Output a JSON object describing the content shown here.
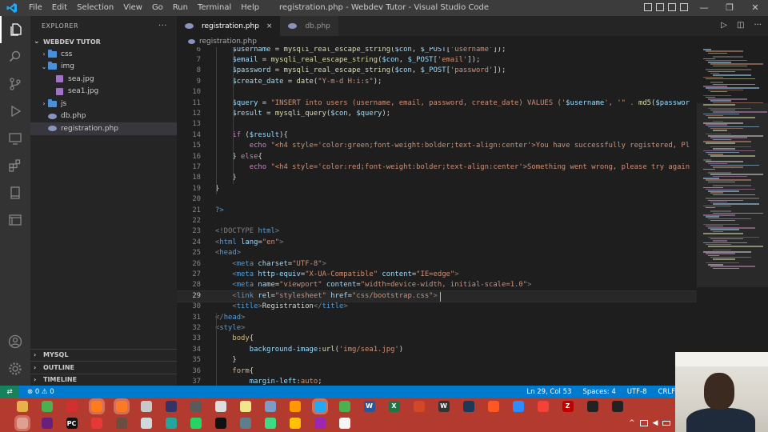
{
  "window": {
    "title": "registration.php - Webdev Tutor - Visual Studio Code",
    "menu": [
      "File",
      "Edit",
      "Selection",
      "View",
      "Go",
      "Run",
      "Terminal",
      "Help"
    ],
    "controls": [
      "—",
      "❐",
      "✕"
    ]
  },
  "activity_bar": {
    "items": [
      "explorer-icon",
      "search-icon",
      "source-control-icon",
      "run-debug-icon",
      "remote-explorer-icon",
      "extensions-icon",
      "notebook-icon",
      "panel-icon"
    ],
    "bottom": [
      "account-icon",
      "settings-gear-icon"
    ]
  },
  "sidebar": {
    "header": "EXPLORER",
    "more": "···",
    "root": "WEBDEV TUTOR",
    "tree": [
      {
        "label": "css",
        "type": "folder",
        "depth": 1,
        "chev": "›"
      },
      {
        "label": "img",
        "type": "folder",
        "depth": 1,
        "chev": "⌄"
      },
      {
        "label": "sea.jpg",
        "type": "image",
        "depth": 2,
        "chev": ""
      },
      {
        "label": "sea1.jpg",
        "type": "image",
        "depth": 2,
        "chev": ""
      },
      {
        "label": "js",
        "type": "folder",
        "depth": 1,
        "chev": "›"
      },
      {
        "label": "db.php",
        "type": "php",
        "depth": 1,
        "chev": ""
      },
      {
        "label": "registration.php",
        "type": "php",
        "depth": 1,
        "chev": "",
        "selected": true
      }
    ],
    "bottom_sections": [
      "MYSQL",
      "OUTLINE",
      "TIMELINE"
    ]
  },
  "tabs": [
    {
      "label": "registration.php",
      "active": true,
      "close": "×"
    },
    {
      "label": "db.php",
      "active": false,
      "close": ""
    }
  ],
  "breadcrumb": "registration.php",
  "editor": {
    "lines": [
      {
        "n": "6",
        "indent": 4,
        "tokens": [
          [
            "$username",
            "#9cdcfe"
          ],
          [
            " = ",
            "#d4d4d4"
          ],
          [
            "mysqli_real_escape_string",
            "#dcdcaa"
          ],
          [
            "(",
            "#d4d4d4"
          ],
          [
            "$con",
            "#9cdcfe"
          ],
          [
            ", ",
            "#d4d4d4"
          ],
          [
            "$_POST",
            "#9cdcfe"
          ],
          [
            "[",
            "#d4d4d4"
          ],
          [
            "'username'",
            "#ce9178"
          ],
          [
            "]);",
            "#d4d4d4"
          ]
        ]
      },
      {
        "n": "7",
        "indent": 4,
        "tokens": [
          [
            "$email",
            "#9cdcfe"
          ],
          [
            " = ",
            "#d4d4d4"
          ],
          [
            "mysqli_real_escape_string",
            "#dcdcaa"
          ],
          [
            "(",
            "#d4d4d4"
          ],
          [
            "$con",
            "#9cdcfe"
          ],
          [
            ", ",
            "#d4d4d4"
          ],
          [
            "$_POST",
            "#9cdcfe"
          ],
          [
            "[",
            "#d4d4d4"
          ],
          [
            "'email'",
            "#ce9178"
          ],
          [
            "]);",
            "#d4d4d4"
          ]
        ]
      },
      {
        "n": "8",
        "indent": 4,
        "tokens": [
          [
            "$password",
            "#9cdcfe"
          ],
          [
            " = ",
            "#d4d4d4"
          ],
          [
            "mysqli_real_escape_string",
            "#dcdcaa"
          ],
          [
            "(",
            "#d4d4d4"
          ],
          [
            "$con",
            "#9cdcfe"
          ],
          [
            ", ",
            "#d4d4d4"
          ],
          [
            "$_POST",
            "#9cdcfe"
          ],
          [
            "[",
            "#d4d4d4"
          ],
          [
            "'password'",
            "#ce9178"
          ],
          [
            "]);",
            "#d4d4d4"
          ]
        ]
      },
      {
        "n": "9",
        "indent": 4,
        "tokens": [
          [
            "$create_date",
            "#9cdcfe"
          ],
          [
            " = ",
            "#d4d4d4"
          ],
          [
            "date",
            "#dcdcaa"
          ],
          [
            "(",
            "#d4d4d4"
          ],
          [
            "\"Y-m-d H:i:s\"",
            "#ce9178"
          ],
          [
            ");",
            "#d4d4d4"
          ]
        ]
      },
      {
        "n": "10",
        "indent": 0,
        "tokens": []
      },
      {
        "n": "11",
        "indent": 4,
        "tokens": [
          [
            "$query",
            "#9cdcfe"
          ],
          [
            " = ",
            "#d4d4d4"
          ],
          [
            "\"INSERT into users (username, email, password, create_date) VALUES ('",
            "#ce9178"
          ],
          [
            "$username",
            "#9cdcfe"
          ],
          [
            "', '\" . ",
            "#ce9178"
          ],
          [
            "md5",
            "#dcdcaa"
          ],
          [
            "(",
            "#d4d4d4"
          ],
          [
            "$passwor",
            "#9cdcfe"
          ]
        ]
      },
      {
        "n": "12",
        "indent": 4,
        "tokens": [
          [
            "$result",
            "#9cdcfe"
          ],
          [
            " = ",
            "#d4d4d4"
          ],
          [
            "mysqli_query",
            "#dcdcaa"
          ],
          [
            "(",
            "#d4d4d4"
          ],
          [
            "$con",
            "#9cdcfe"
          ],
          [
            ", ",
            "#d4d4d4"
          ],
          [
            "$query",
            "#9cdcfe"
          ],
          [
            ");",
            "#d4d4d4"
          ]
        ]
      },
      {
        "n": "13",
        "indent": 0,
        "tokens": []
      },
      {
        "n": "14",
        "indent": 4,
        "tokens": [
          [
            "if",
            "#c586c0"
          ],
          [
            " (",
            "#d4d4d4"
          ],
          [
            "$result",
            "#9cdcfe"
          ],
          [
            "){",
            "#d4d4d4"
          ]
        ]
      },
      {
        "n": "15",
        "indent": 8,
        "tokens": [
          [
            "echo",
            "#c586c0"
          ],
          [
            " ",
            "#d4d4d4"
          ],
          [
            "\"<h4 style='color:green;font-weight:bolder;text-align:center'>You have successfully registered, Pl",
            "#ce9178"
          ]
        ]
      },
      {
        "n": "16",
        "indent": 4,
        "tokens": [
          [
            "}",
            "#d4d4d4"
          ],
          [
            " else",
            "#c586c0"
          ],
          [
            "{",
            "#d4d4d4"
          ]
        ]
      },
      {
        "n": "17",
        "indent": 8,
        "tokens": [
          [
            "echo",
            "#c586c0"
          ],
          [
            " ",
            "#d4d4d4"
          ],
          [
            "\"<h4 style='color:red;font-weight:bolder;text-align:center'>Something went wrong, please try again",
            "#ce9178"
          ]
        ]
      },
      {
        "n": "18",
        "indent": 4,
        "tokens": [
          [
            "}",
            "#d4d4d4"
          ]
        ]
      },
      {
        "n": "19",
        "indent": 0,
        "tokens": [
          [
            "}",
            "#d4d4d4"
          ]
        ]
      },
      {
        "n": "20",
        "indent": 0,
        "tokens": []
      },
      {
        "n": "21",
        "indent": 0,
        "tokens": [
          [
            "?>",
            "#569cd6"
          ]
        ]
      },
      {
        "n": "22",
        "indent": 0,
        "tokens": []
      },
      {
        "n": "23",
        "indent": 0,
        "tokens": [
          [
            "<!DOCTYPE ",
            "#808080"
          ],
          [
            "html",
            "#569cd6"
          ],
          [
            ">",
            "#808080"
          ]
        ]
      },
      {
        "n": "24",
        "indent": 0,
        "tokens": [
          [
            "<",
            "#808080"
          ],
          [
            "html",
            "#569cd6"
          ],
          [
            " lang",
            "#9cdcfe"
          ],
          [
            "=",
            "#d4d4d4"
          ],
          [
            "\"en\"",
            "#ce9178"
          ],
          [
            ">",
            "#808080"
          ]
        ]
      },
      {
        "n": "25",
        "indent": 0,
        "tokens": [
          [
            "<",
            "#808080"
          ],
          [
            "head",
            "#569cd6"
          ],
          [
            ">",
            "#808080"
          ]
        ]
      },
      {
        "n": "26",
        "indent": 4,
        "tokens": [
          [
            "<",
            "#808080"
          ],
          [
            "meta",
            "#569cd6"
          ],
          [
            " charset",
            "#9cdcfe"
          ],
          [
            "=",
            "#d4d4d4"
          ],
          [
            "\"UTF-8\"",
            "#ce9178"
          ],
          [
            ">",
            "#808080"
          ]
        ]
      },
      {
        "n": "27",
        "indent": 4,
        "tokens": [
          [
            "<",
            "#808080"
          ],
          [
            "meta",
            "#569cd6"
          ],
          [
            " http-equiv",
            "#9cdcfe"
          ],
          [
            "=",
            "#d4d4d4"
          ],
          [
            "\"X-UA-Compatible\"",
            "#ce9178"
          ],
          [
            " content",
            "#9cdcfe"
          ],
          [
            "=",
            "#d4d4d4"
          ],
          [
            "\"IE=edge\"",
            "#ce9178"
          ],
          [
            ">",
            "#808080"
          ]
        ]
      },
      {
        "n": "28",
        "indent": 4,
        "tokens": [
          [
            "<",
            "#808080"
          ],
          [
            "meta",
            "#569cd6"
          ],
          [
            " name",
            "#9cdcfe"
          ],
          [
            "=",
            "#d4d4d4"
          ],
          [
            "\"viewport\"",
            "#ce9178"
          ],
          [
            " content",
            "#9cdcfe"
          ],
          [
            "=",
            "#d4d4d4"
          ],
          [
            "\"width=device-width, initial-scale=1.0\"",
            "#ce9178"
          ],
          [
            ">",
            "#808080"
          ]
        ]
      },
      {
        "n": "29",
        "indent": 4,
        "current": true,
        "tokens": [
          [
            "<",
            "#808080"
          ],
          [
            "link",
            "#569cd6"
          ],
          [
            " rel",
            "#9cdcfe"
          ],
          [
            "=",
            "#d4d4d4"
          ],
          [
            "\"stylesheet\"",
            "#ce9178"
          ],
          [
            " href",
            "#9cdcfe"
          ],
          [
            "=",
            "#d4d4d4"
          ],
          [
            "\"css/bootstrap.css\"",
            "#ce9178"
          ],
          [
            ">",
            "#808080"
          ]
        ]
      },
      {
        "n": "30",
        "indent": 4,
        "tokens": [
          [
            "<",
            "#808080"
          ],
          [
            "title",
            "#569cd6"
          ],
          [
            ">",
            "#808080"
          ],
          [
            "Registration",
            "#d4d4d4"
          ],
          [
            "</",
            "#808080"
          ],
          [
            "title",
            "#569cd6"
          ],
          [
            ">",
            "#808080"
          ]
        ]
      },
      {
        "n": "31",
        "indent": 0,
        "tokens": [
          [
            "</",
            "#808080"
          ],
          [
            "head",
            "#569cd6"
          ],
          [
            ">",
            "#808080"
          ]
        ]
      },
      {
        "n": "32",
        "indent": 0,
        "tokens": [
          [
            "<",
            "#808080"
          ],
          [
            "style",
            "#569cd6"
          ],
          [
            ">",
            "#808080"
          ]
        ]
      },
      {
        "n": "33",
        "indent": 4,
        "tokens": [
          [
            "body",
            "#d7ba7d"
          ],
          [
            "{",
            "#d4d4d4"
          ]
        ]
      },
      {
        "n": "34",
        "indent": 8,
        "tokens": [
          [
            "background-image",
            "#9cdcfe"
          ],
          [
            ":",
            "#d4d4d4"
          ],
          [
            "url",
            "#dcdcaa"
          ],
          [
            "(",
            "#d4d4d4"
          ],
          [
            "'img/sea1.jpg'",
            "#ce9178"
          ],
          [
            ")",
            "#d4d4d4"
          ]
        ]
      },
      {
        "n": "35",
        "indent": 4,
        "tokens": [
          [
            "}",
            "#d4d4d4"
          ]
        ]
      },
      {
        "n": "36",
        "indent": 4,
        "tokens": [
          [
            "form",
            "#d7ba7d"
          ],
          [
            "{",
            "#d4d4d4"
          ]
        ]
      },
      {
        "n": "37",
        "indent": 8,
        "tokens": [
          [
            "margin-left",
            "#9cdcfe"
          ],
          [
            ":",
            "#d4d4d4"
          ],
          [
            "auto",
            "#ce9178"
          ],
          [
            ";",
            "#d4d4d4"
          ]
        ]
      }
    ]
  },
  "statusbar": {
    "remote": "⇄",
    "problems": "⊗ 0 ⚠ 0",
    "position": "Ln 29, Col 53",
    "spaces": "Spaces: 4",
    "encoding": "UTF-8",
    "eol": "CRLF"
  },
  "taskbar_top": {
    "icons": [
      {
        "name": "folder-icon",
        "color": "#e8b04a"
      },
      {
        "name": "chrome-icon",
        "color": "#4caf50"
      },
      {
        "name": "opera-icon",
        "color": "#d32f2f"
      },
      {
        "name": "firefox-icon",
        "color": "#ff7b1c",
        "active": true
      },
      {
        "name": "xampp-icon",
        "color": "#fb7a24",
        "active": true
      },
      {
        "name": "bin-icon",
        "color": "#c8c8c8"
      },
      {
        "name": "media-icon",
        "color": "#333366"
      },
      {
        "name": "app-icon",
        "color": "#5a5a5a"
      },
      {
        "name": "tools-icon",
        "color": "#dddddd"
      },
      {
        "name": "notes-icon",
        "color": "#f0e68c"
      },
      {
        "name": "box-icon",
        "color": "#7a9cc6"
      },
      {
        "name": "sublime-icon",
        "color": "#ff9800"
      },
      {
        "name": "vscode-icon",
        "color": "#23a9f2",
        "active": true
      },
      {
        "name": "green-app-icon",
        "color": "#4caf50"
      },
      {
        "name": "word-icon",
        "color": "#2b579a",
        "text": "W"
      },
      {
        "name": "excel-icon",
        "color": "#217346",
        "text": "X"
      },
      {
        "name": "powerpoint-icon",
        "color": "#d24726"
      },
      {
        "name": "wordpad-icon",
        "color": "#333333",
        "text": "W"
      },
      {
        "name": "camtasia-icon",
        "color": "#1c3a57"
      },
      {
        "name": "record-icon",
        "color": "#ff5722"
      },
      {
        "name": "zoom-icon",
        "color": "#2d8cff"
      },
      {
        "name": "flag-icon",
        "color": "#f44336"
      },
      {
        "name": "filezilla-icon",
        "color": "#bf0000",
        "text": "Z"
      },
      {
        "name": "server-icon",
        "color": "#222222"
      },
      {
        "name": "git-icon",
        "color": "#222222"
      }
    ]
  },
  "taskbar_bottom": {
    "icons": [
      {
        "name": "start-icon",
        "color": "#e0a090",
        "active": true
      },
      {
        "name": "vs-icon",
        "color": "#68217a"
      },
      {
        "name": "pycharm-icon",
        "color": "#111111",
        "text": "PC"
      },
      {
        "name": "red-app-icon",
        "color": "#e53935"
      },
      {
        "name": "brown-app-icon",
        "color": "#6d4c41"
      },
      {
        "name": "window-icon",
        "color": "#cfd8dc"
      },
      {
        "name": "phone-icon",
        "color": "#26a69a"
      },
      {
        "name": "whatsapp-icon",
        "color": "#25d366"
      },
      {
        "name": "jetbrains-icon",
        "color": "#111111"
      },
      {
        "name": "calc-icon",
        "color": "#607d8b"
      },
      {
        "name": "android-studio-icon",
        "color": "#3ddc84"
      },
      {
        "name": "layers-icon",
        "color": "#ffc107"
      },
      {
        "name": "steam-icon",
        "color": "#9c27b0"
      },
      {
        "name": "github-icon",
        "color": "#f5f5f5"
      }
    ],
    "tray": [
      "chevron-up-icon",
      "network-icon",
      "volume-icon",
      "battery-icon",
      "sync-icon"
    ]
  },
  "colors": {
    "accent": "#007acc",
    "taskbar": "#b23a2e",
    "titlebar": "#3c3c3c"
  }
}
